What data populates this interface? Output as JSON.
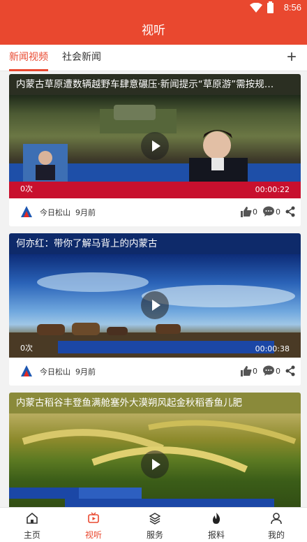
{
  "status_bar": {
    "time": "8:56"
  },
  "header": {
    "title": "视听"
  },
  "tabs": [
    {
      "label": "新闻视频",
      "active": true
    },
    {
      "label": "社会新闻",
      "active": false
    }
  ],
  "add_tab_label": "+",
  "cards": [
    {
      "title": "内蒙古草原遭数辆越野车肆意碾压·新闻提示“草原游”需按规…",
      "view_count": "0次",
      "duration": "00:00:22",
      "source": "今日松山",
      "age": "9月前",
      "likes": "0",
      "comments": "0"
    },
    {
      "title": "何亦红：带你了解马背上的内蒙古",
      "view_count": "0次",
      "duration": "00:00:38",
      "source": "今日松山",
      "age": "9月前",
      "likes": "0",
      "comments": "0"
    },
    {
      "title": "内蒙古稻谷丰登鱼满舱塞外大漠朔风起金秋稻香鱼儿肥"
    }
  ],
  "bottom_nav": [
    {
      "label": "主页",
      "icon": "home-icon",
      "active": false
    },
    {
      "label": "视听",
      "icon": "video-icon",
      "active": true
    },
    {
      "label": "服务",
      "icon": "layers-icon",
      "active": false
    },
    {
      "label": "报料",
      "icon": "flame-icon",
      "active": false
    },
    {
      "label": "我的",
      "icon": "user-icon",
      "active": false
    }
  ],
  "colors": {
    "brand": "#e9482f",
    "text": "#333333",
    "background": "#f2f2f2"
  }
}
